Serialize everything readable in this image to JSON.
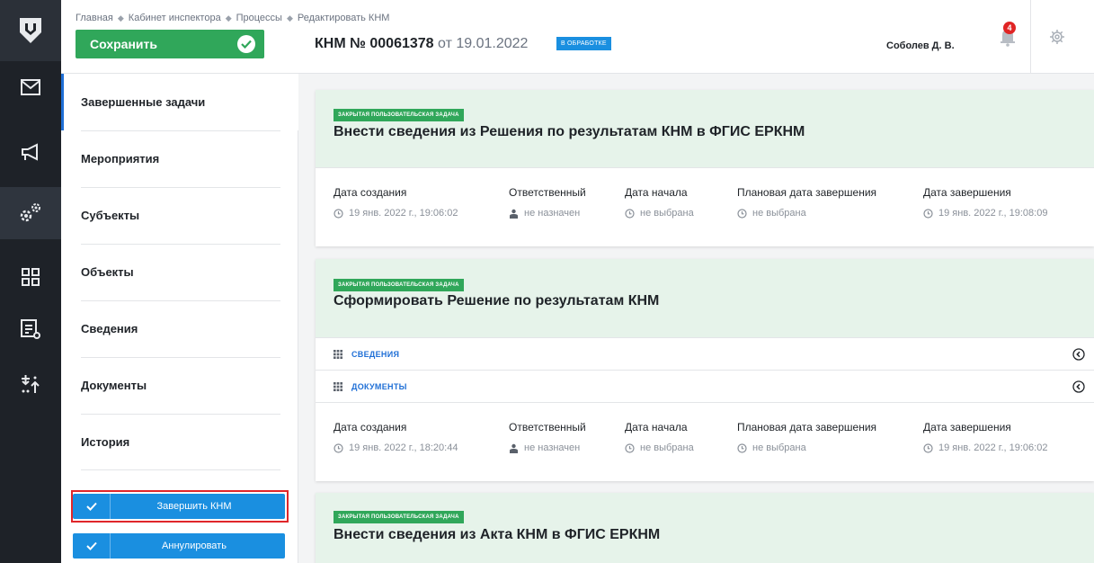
{
  "rail": {
    "icons": [
      "shield-logo-icon",
      "mail-icon",
      "megaphone-icon",
      "gears-icon",
      "dashboard-icon",
      "report-icon",
      "process-icon"
    ]
  },
  "header": {
    "breadcrumbs": [
      "Главная",
      "Кабинет инспектора",
      "Процессы",
      "Редактировать КНМ"
    ],
    "save_label": "Сохранить",
    "knm_number": "КНМ № 00061378",
    "knm_date": "от 19.01.2022",
    "status_badge": "В ОБРАБОТКЕ",
    "user_name": "Соболев Д. В.",
    "notifications_count": "4"
  },
  "sidebar": {
    "items": [
      {
        "label": "Завершенные задачи",
        "active": true
      },
      {
        "label": "Мероприятия",
        "active": false
      },
      {
        "label": "Субъекты",
        "active": false
      },
      {
        "label": "Объекты",
        "active": false
      },
      {
        "label": "Сведения",
        "active": false
      },
      {
        "label": "Документы",
        "active": false
      },
      {
        "label": "История",
        "active": false
      }
    ],
    "finish_label": "Завершить КНМ",
    "cancel_label": "Аннулировать"
  },
  "meta_labels": {
    "created": "Дата создания",
    "responsible": "Ответственный",
    "start": "Дата начала",
    "planned_end": "Плановая дата завершения",
    "end": "Дата завершения"
  },
  "tasks": [
    {
      "tag": "ЗАКРЫТАЯ ПОЛЬЗОВАТЕЛЬСКАЯ ЗАДАЧА",
      "title": "Внести сведения из Решения по результатам КНМ в ФГИС ЕРКНМ",
      "created": "19 янв. 2022 г., 19:06:02",
      "responsible": "не назначен",
      "start": "не выбрана",
      "planned_end": "не выбрана",
      "end": "19 янв. 2022 г., 19:08:09"
    },
    {
      "tag": "ЗАКРЫТАЯ ПОЛЬЗОВАТЕЛЬСКАЯ ЗАДАЧА",
      "title": "Сформировать Решение по результатам КНМ",
      "rows": [
        "СВЕДЕНИЯ",
        "ДОКУМЕНТЫ"
      ],
      "created": "19 янв. 2022 г., 18:20:44",
      "responsible": "не назначен",
      "start": "не выбрана",
      "planned_end": "не выбрана",
      "end": "19 янв. 2022 г., 19:06:02"
    },
    {
      "tag": "ЗАКРЫТАЯ ПОЛЬЗОВАТЕЛЬСКАЯ ЗАДАЧА",
      "title": "Внести сведения из Акта КНМ в ФГИС ЕРКНМ"
    }
  ],
  "colors": {
    "rail_bg": "#1e2228",
    "save_green": "#30a75a",
    "accent_blue": "#1a8fe0",
    "card_header_bg": "#e6f3ea",
    "highlight_red": "#e0262a"
  }
}
